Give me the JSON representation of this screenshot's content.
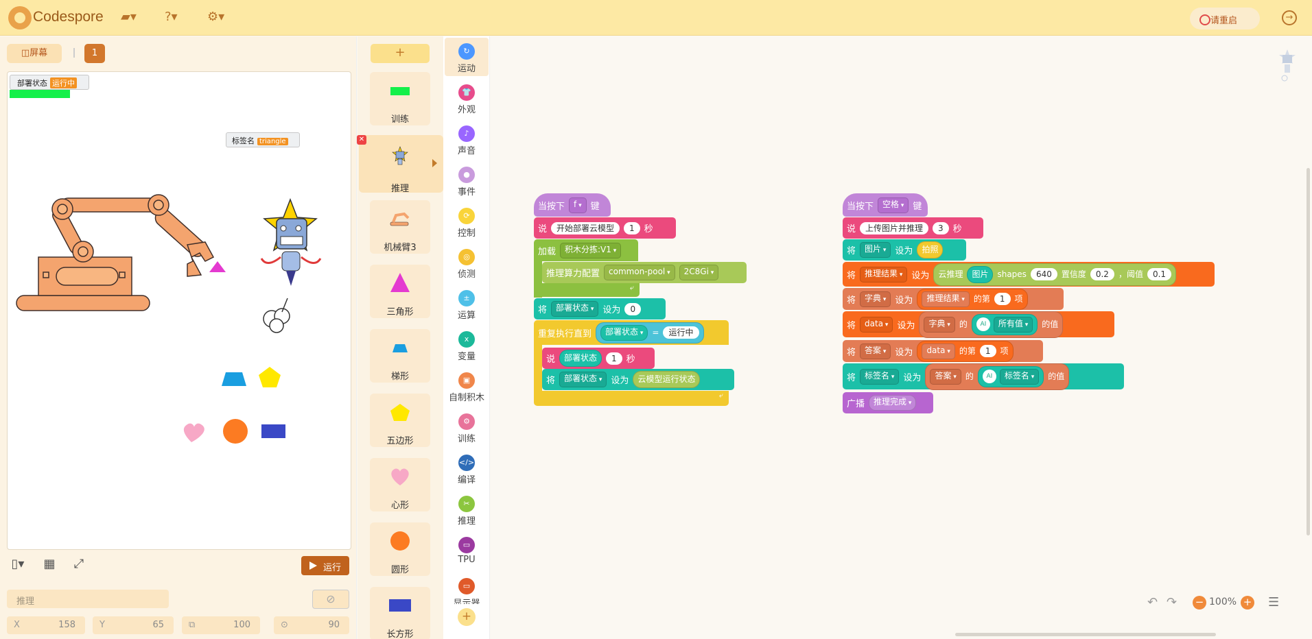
{
  "app": {
    "title": "Codespore",
    "restart_label": "请重启"
  },
  "stage": {
    "screen_label": "屏幕",
    "page_num": "1",
    "monitor1": {
      "label": "部署状态",
      "value": "运行中"
    },
    "monitor2": {
      "label": "标签名",
      "value": "triangle"
    },
    "run_label": "运行",
    "sprite_name_placeholder": "推理",
    "x_label": "X",
    "x": "158",
    "y_label": "Y",
    "y": "65",
    "size": "100",
    "direction": "90"
  },
  "sprites": {
    "add_label": "+",
    "items": [
      {
        "name": "训练"
      },
      {
        "name": "推理"
      },
      {
        "name": "机械臂3"
      },
      {
        "name": "三角形"
      },
      {
        "name": "梯形"
      },
      {
        "name": "五边形"
      },
      {
        "name": "心形"
      },
      {
        "name": "圆形"
      },
      {
        "name": "长方形"
      }
    ]
  },
  "categories": [
    {
      "name": "运动",
      "color": "#4c97ff"
    },
    {
      "name": "外观",
      "color": "#e74c8c"
    },
    {
      "name": "声音",
      "color": "#9966ff"
    },
    {
      "name": "事件",
      "color": "#c99bdd"
    },
    {
      "name": "控制",
      "color": "#f9d43a"
    },
    {
      "name": "侦测",
      "color": "#f5c132"
    },
    {
      "name": "运算",
      "color": "#4fc0e8"
    },
    {
      "name": "变量",
      "color": "#1cb99a"
    },
    {
      "name": "自制积木",
      "color": "#f0864a"
    },
    {
      "name": "训练",
      "color": "#e8739a"
    },
    {
      "name": "编译",
      "color": "#2f6db8"
    },
    {
      "name": "推理",
      "color": "#8cc63f"
    },
    {
      "name": "TPU",
      "color": "#9b3aa0"
    },
    {
      "name": "显示器",
      "color": "#e05a2a"
    }
  ],
  "zoom": {
    "level": "100%"
  },
  "script1": {
    "hat": {
      "when": "当按下",
      "key": "f",
      "suffix": "键"
    },
    "say1": {
      "say": "说",
      "text": "开始部署云模型",
      "n": "1",
      "unit": "秒"
    },
    "load": {
      "label": "加载",
      "model": "积木分拣:V1"
    },
    "config": {
      "label": "推理算力配置",
      "pool": "common-pool",
      "spec": "2C8Gi"
    },
    "set1": {
      "set": "将",
      "var": "部署状态",
      "to": "设为",
      "value": "0"
    },
    "repeat": {
      "label": "重复执行直到",
      "var": "部署状态",
      "op": "=",
      "value": "运行中"
    },
    "say2": {
      "say": "说",
      "var": "部署状态",
      "n": "1",
      "unit": "秒"
    },
    "set2": {
      "set": "将",
      "var": "部署状态",
      "to": "设为",
      "value": "云模型运行状态"
    }
  },
  "script2": {
    "hat": {
      "when": "当按下",
      "key": "空格",
      "suffix": "键"
    },
    "say": {
      "say": "说",
      "text": "上传图片并推理",
      "n": "3",
      "unit": "秒"
    },
    "set_img": {
      "set": "将",
      "var": "图片",
      "to": "设为",
      "value": "拍照"
    },
    "set_result": {
      "set": "将",
      "var": "推理结果",
      "to": "设为",
      "fn": "云推理",
      "img": "图片",
      "shapes_label": "shapes",
      "shapes": "640",
      "conf_label": "置信度",
      "conf": "0.2",
      "comma": "，阈值",
      "thresh": "0.1"
    },
    "set_dict": {
      "set": "将",
      "var": "字典",
      "to": "设为",
      "src": "推理结果",
      "of": "的第",
      "n": "1",
      "item": "项"
    },
    "set_data": {
      "set": "将",
      "var": "data",
      "to": "设为",
      "src": "字典",
      "of": "的",
      "key": "所有值",
      "suffix": "的值"
    },
    "set_answer": {
      "set": "将",
      "var": "答案",
      "to": "设为",
      "src": "data",
      "of": "的第",
      "n": "1",
      "item": "项"
    },
    "set_label": {
      "set": "将",
      "var": "标签名",
      "to": "设为",
      "src": "答案",
      "of": "的",
      "key": "标签名",
      "suffix": "的值"
    },
    "broadcast": {
      "label": "广播",
      "msg": "推理完成"
    }
  }
}
